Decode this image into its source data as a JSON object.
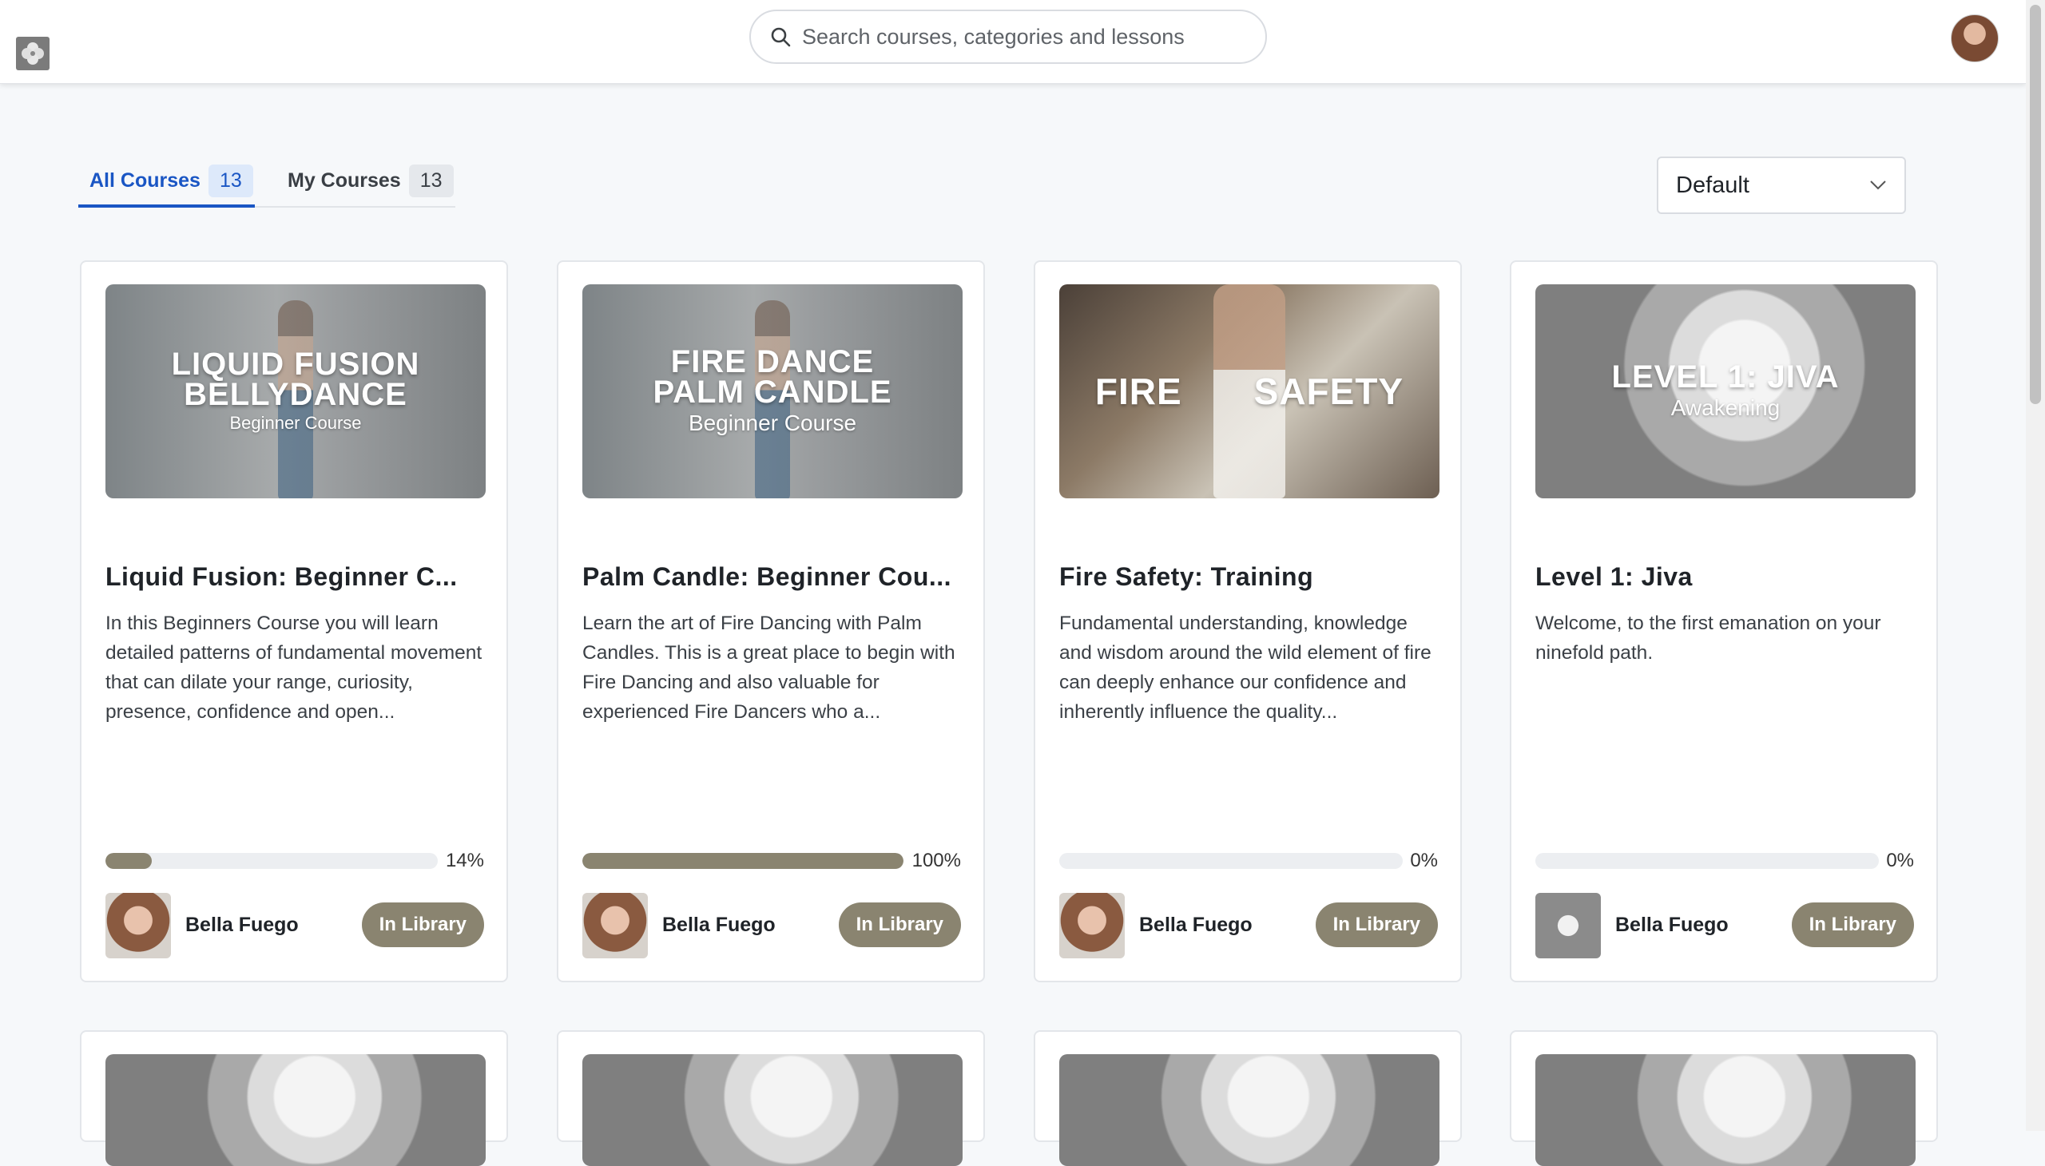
{
  "header": {
    "logo_icon": "flower-logo-icon",
    "search_placeholder": "Search courses, categories and lessons",
    "search_icon": "search-icon",
    "avatar_icon": "user-avatar"
  },
  "tabs": [
    {
      "label": "All Courses",
      "count": "13",
      "active": true
    },
    {
      "label": "My Courses",
      "count": "13",
      "active": false
    }
  ],
  "sort": {
    "selected": "Default",
    "icon": "chevron-down-icon"
  },
  "colors": {
    "accent_blue": "#1a56c4",
    "brand_olive": "#8a8470"
  },
  "courses": [
    {
      "thumb_title_1": "LIQUID FUSION",
      "thumb_title_2": "BELLYDANCE",
      "thumb_subtitle": "Beginner Course",
      "title": "Liquid Fusion: Beginner C...",
      "description": "In this Beginners Course you will learn detailed patterns of fundamental movement that can dilate your range, curiosity, presence, confidence and open...",
      "progress": 14,
      "progress_label": "14%",
      "author": "Bella Fuego",
      "button": "In Library"
    },
    {
      "thumb_title_1": "FIRE DANCE",
      "thumb_title_2": "PALM CANDLE",
      "thumb_subtitle": "Beginner Course",
      "title": "Palm Candle: Beginner Cou...",
      "description": "Learn the art of Fire Dancing with Palm Candles. This is a great place to begin with Fire Dancing and also valuable for experienced Fire Dancers who a...",
      "progress": 100,
      "progress_label": "100%",
      "author": "Bella Fuego",
      "button": "In Library"
    },
    {
      "thumb_title_1": "FIRE",
      "thumb_title_2": "SAFETY",
      "thumb_subtitle": "",
      "title": "Fire Safety: Training",
      "description": "Fundamental understanding, knowledge and wisdom around the wild element of fire can deeply enhance our confidence and inherently influence the quality...",
      "progress": 0,
      "progress_label": "0%",
      "author": "Bella Fuego",
      "button": "In Library"
    },
    {
      "thumb_title_1": "LEVEL 1: JIVA",
      "thumb_title_2": "",
      "thumb_subtitle": "Awakening",
      "title": "Level 1: Jiva",
      "description": "Welcome, to the first emanation on your ninefold path.",
      "progress": 0,
      "progress_label": "0%",
      "author": "Bella Fuego",
      "button": "In Library"
    }
  ]
}
